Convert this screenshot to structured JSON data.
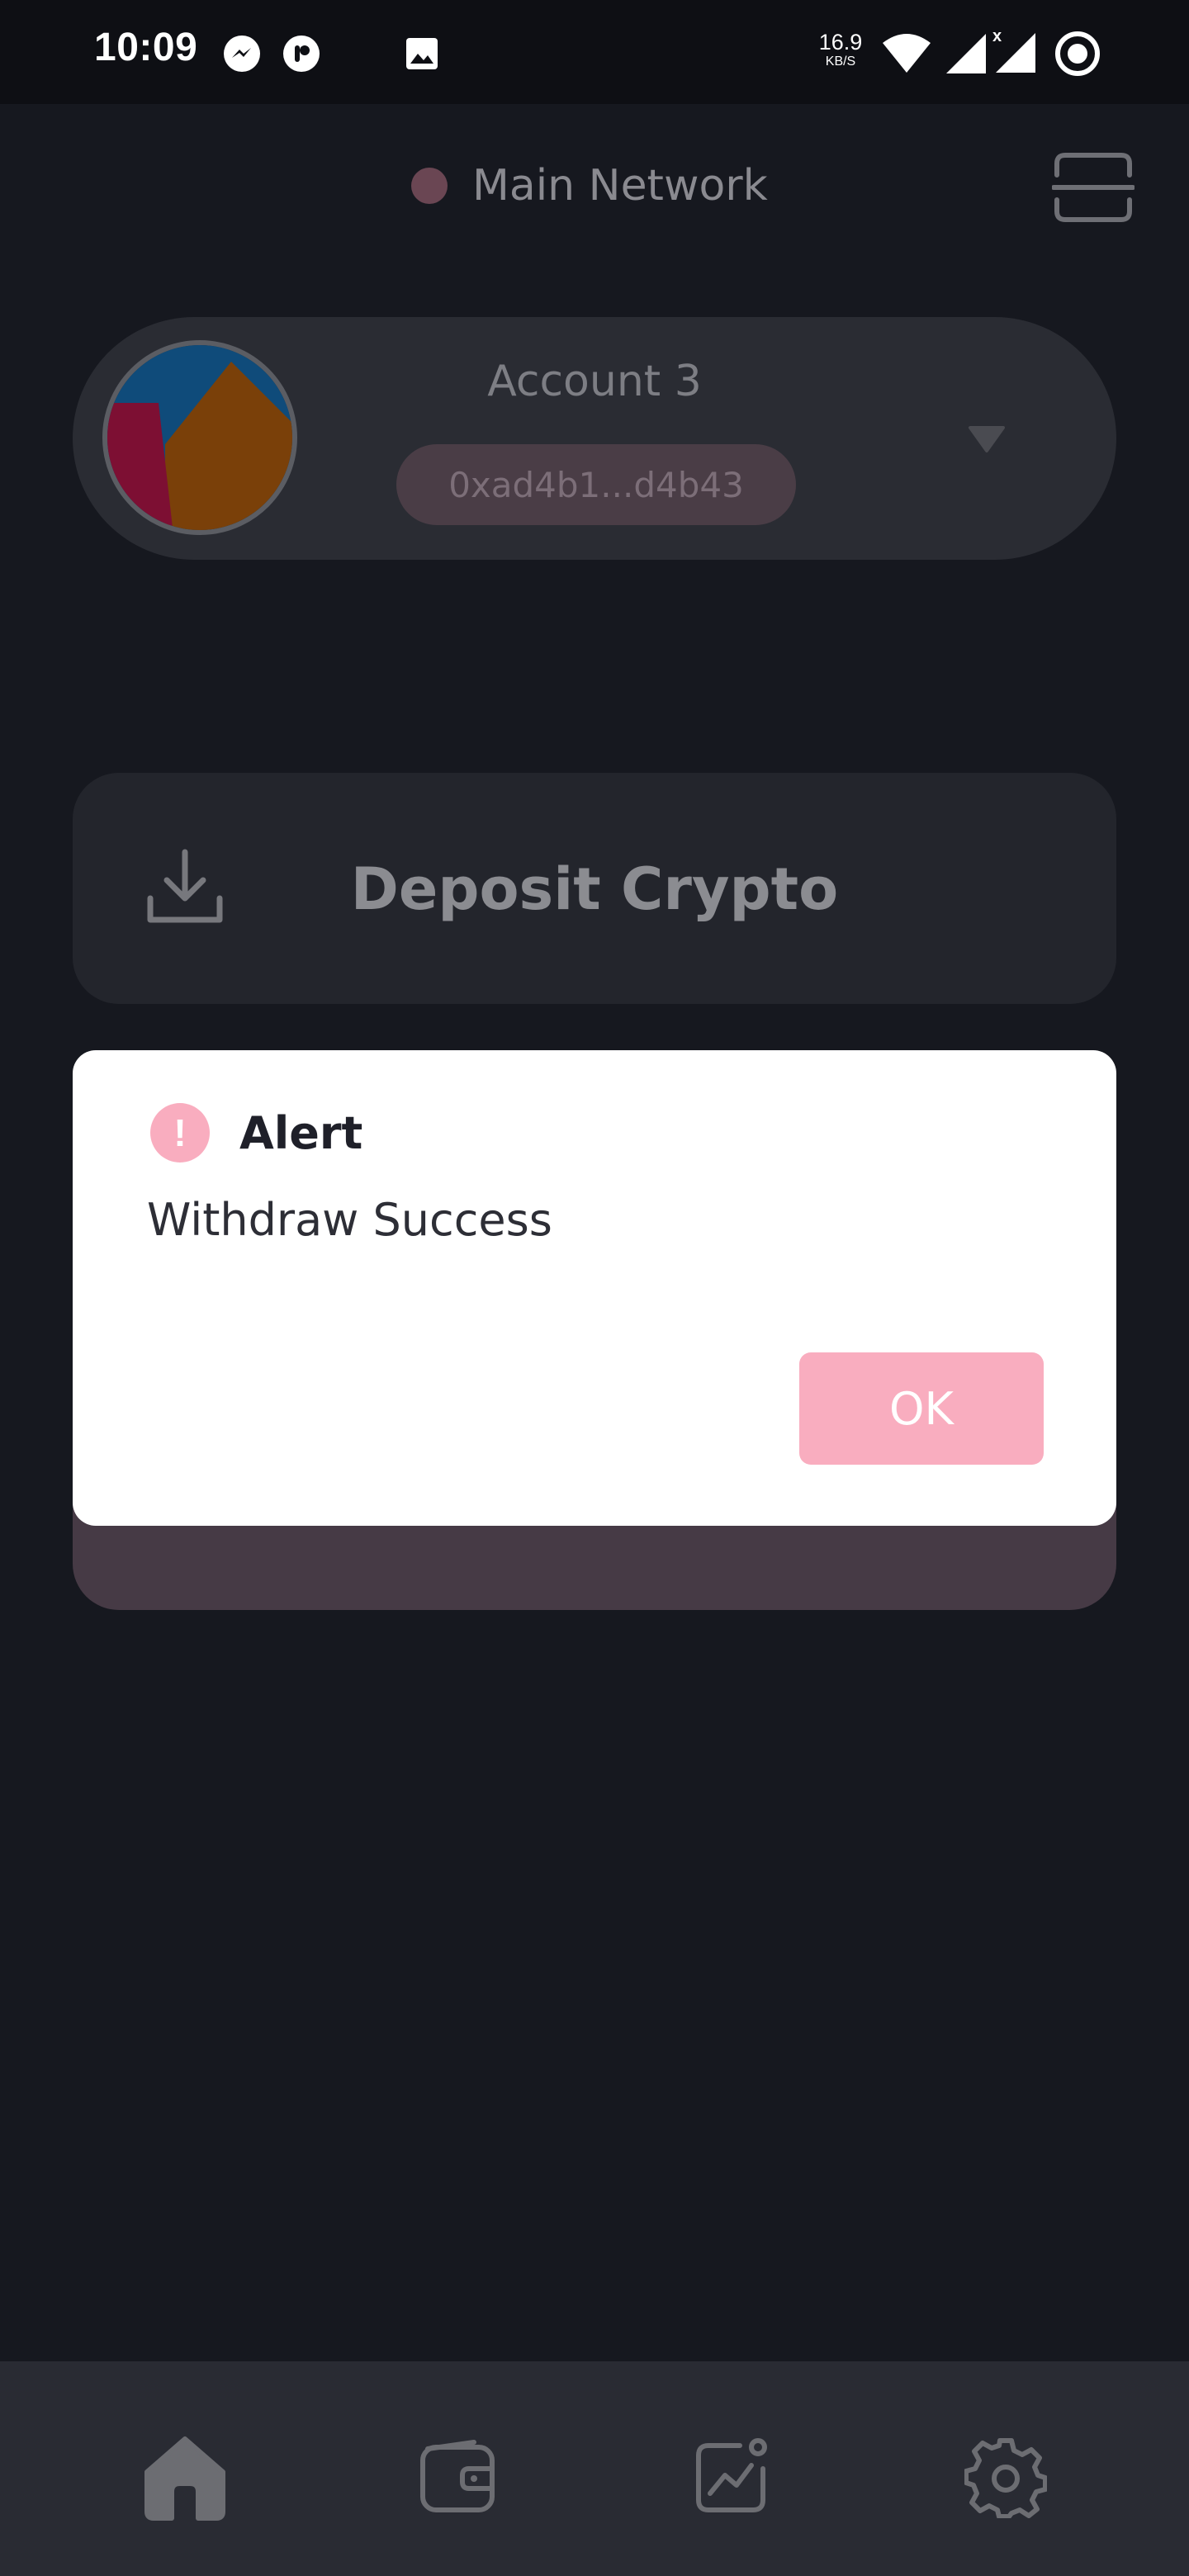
{
  "status_bar": {
    "time": "10:09",
    "net_speed_value": "16.9",
    "net_speed_unit": "KB/S",
    "icons": [
      "messenger-icon",
      "pocketcasts-icon",
      "gallery-icon",
      "wifi-icon",
      "signal-icon",
      "signal-no-data-icon",
      "record-icon"
    ]
  },
  "header": {
    "network_label": "Main Network",
    "network_dot_color": "#6a4653",
    "scan_icon": "scan-icon"
  },
  "account": {
    "name": "Account 3",
    "address": "0xad4b1...d4b43",
    "avatar_icon": "jazzicon-avatar",
    "chevron_icon": "chevron-down-icon"
  },
  "actions": {
    "deposit_label": "Deposit Crypto",
    "deposit_icon": "download-icon"
  },
  "dialog": {
    "title": "Alert",
    "message": "Withdraw Success",
    "ok_label": "OK",
    "accent_color": "#f9adbf",
    "icon": "exclamation-icon"
  },
  "bottom_nav": {
    "items": [
      "home-icon",
      "wallet-icon",
      "chart-icon",
      "settings-icon"
    ],
    "active": "home-icon"
  }
}
